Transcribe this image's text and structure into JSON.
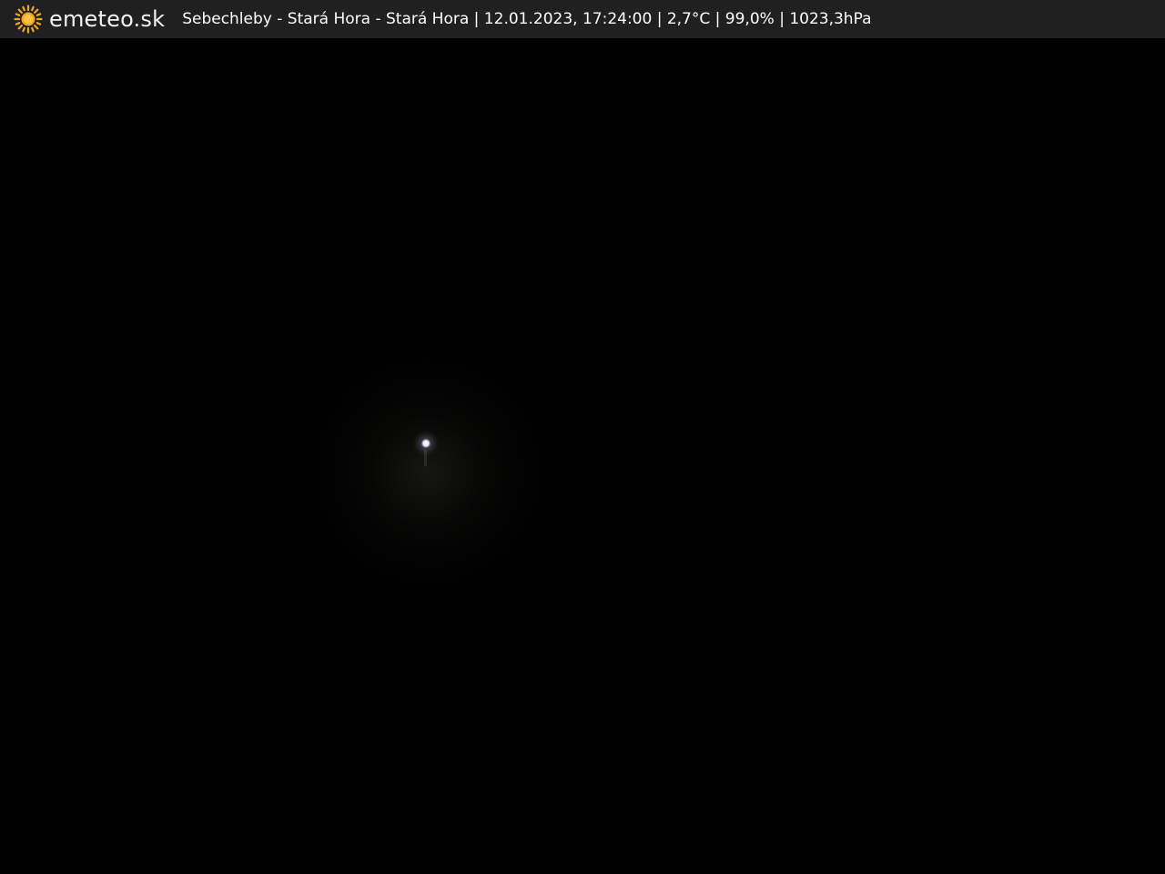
{
  "header": {
    "logo_text": "emeteo.sk",
    "logo_icon": "sun-icon",
    "caption": "Sebechleby - Stará Hora - Stará Hora | 12.01.2023, 17:24:00 | 2,7°C | 99,0% | 1023,3hPa"
  },
  "colors": {
    "bar_background": "#202020",
    "sun": "#f5a623",
    "text": "#ffffff",
    "image_background": "#000000"
  }
}
